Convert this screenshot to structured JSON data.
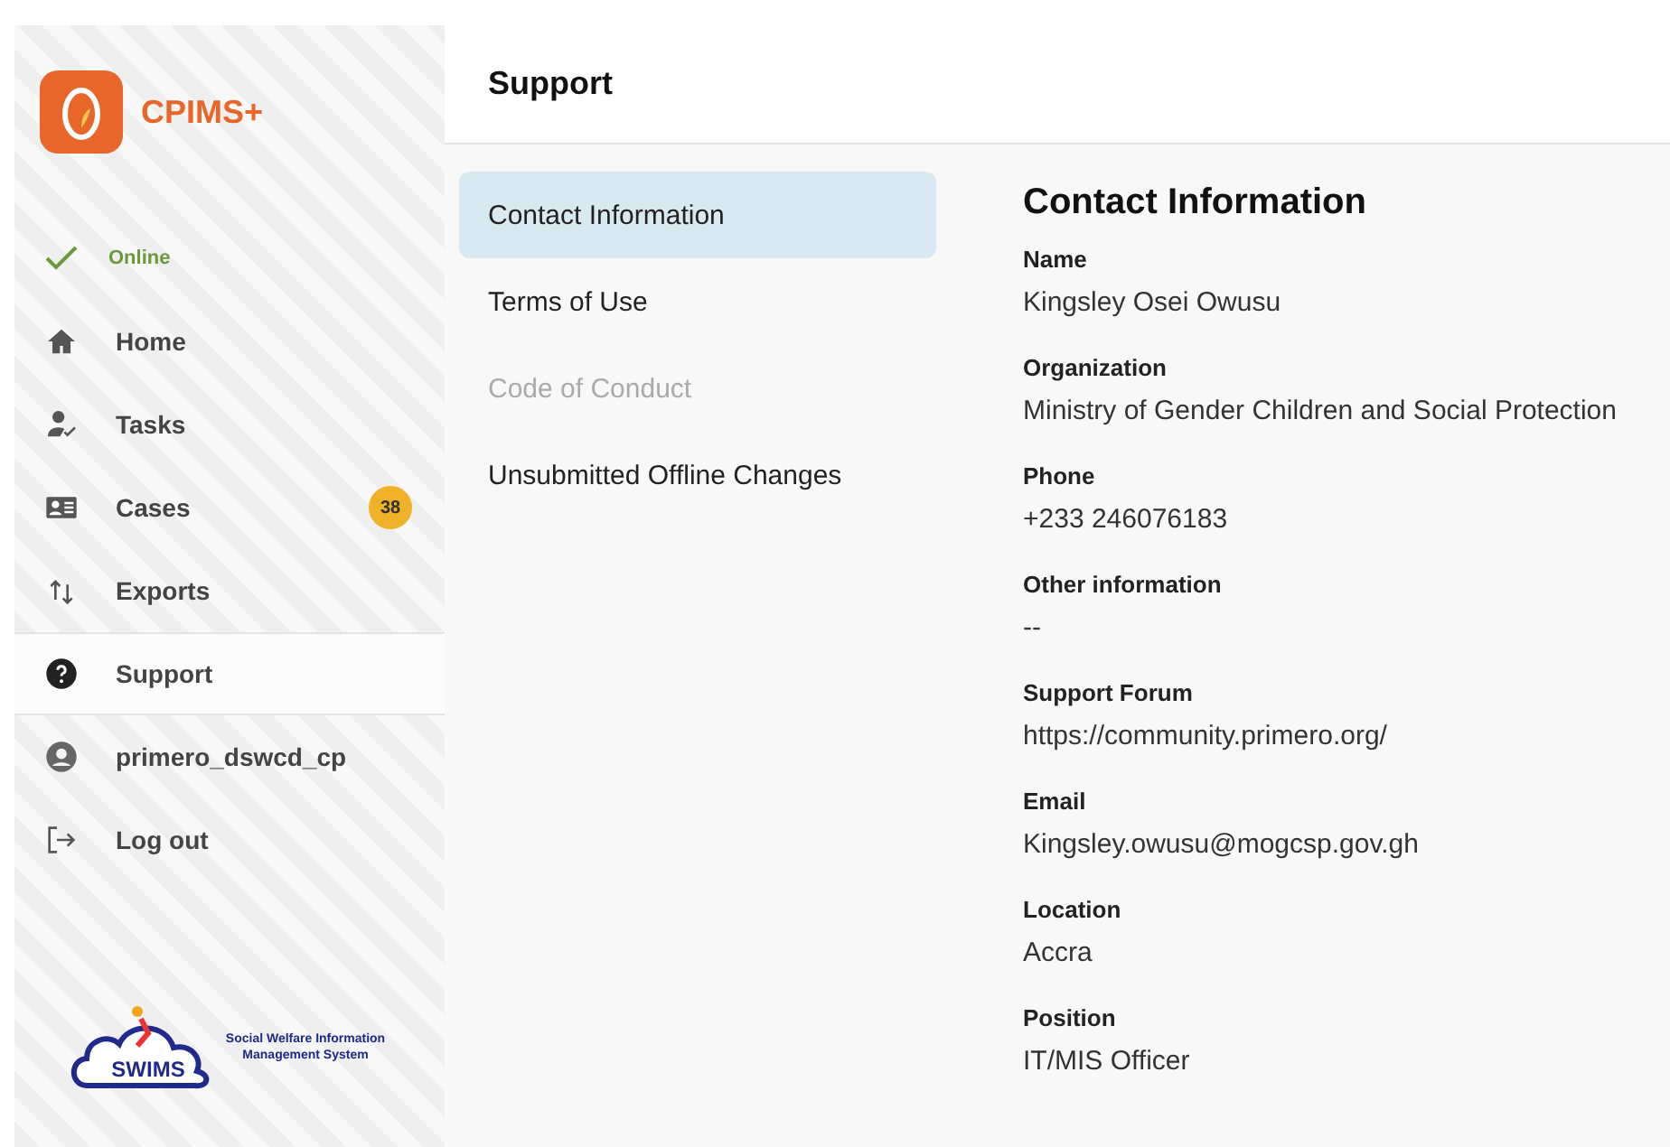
{
  "app": {
    "name": "CPIMS+"
  },
  "status": {
    "label": "Online",
    "online": true
  },
  "nav": [
    {
      "label": "Home",
      "selected": false
    },
    {
      "label": "Tasks",
      "selected": false
    },
    {
      "label": "Cases",
      "selected": false,
      "badge": "38"
    },
    {
      "label": "Exports",
      "selected": false
    },
    {
      "label": "Support",
      "selected": true
    },
    {
      "label": "primero_dswcd_cp",
      "selected": false
    },
    {
      "label": "Log out",
      "selected": false
    }
  ],
  "footer_logo": {
    "mark": "SWIMS",
    "caption": "Social Welfare Information Management System"
  },
  "page": {
    "title": "Support"
  },
  "support_menu": [
    {
      "label": "Contact Information",
      "selected": true,
      "disabled": false
    },
    {
      "label": "Terms of Use",
      "selected": false,
      "disabled": false
    },
    {
      "label": "Code of Conduct",
      "selected": false,
      "disabled": true
    },
    {
      "label": "Unsubmitted Offline Changes",
      "selected": false,
      "disabled": false
    }
  ],
  "contact": {
    "title": "Contact Information",
    "fields": [
      {
        "label": "Name",
        "value": "Kingsley Osei Owusu"
      },
      {
        "label": "Organization",
        "value": "Ministry of Gender Children and Social Protection"
      },
      {
        "label": "Phone",
        "value": "+233 246076183"
      },
      {
        "label": "Other information",
        "value": "--"
      },
      {
        "label": "Support Forum",
        "value": "https://community.primero.org/"
      },
      {
        "label": "Email",
        "value": "Kingsley.owusu@mogcsp.gov.gh"
      },
      {
        "label": "Location",
        "value": "Accra"
      },
      {
        "label": "Position",
        "value": "IT/MIS Officer"
      }
    ]
  }
}
